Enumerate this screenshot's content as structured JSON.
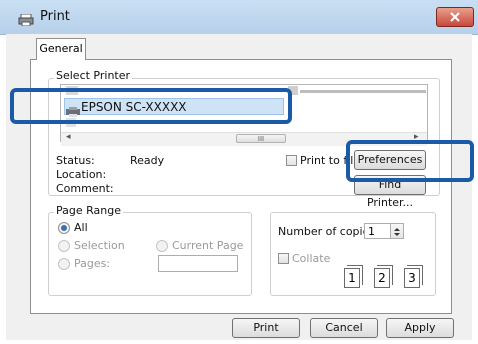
{
  "window": {
    "title": "Print",
    "title_icon": "printer-icon",
    "close_icon": "close-icon"
  },
  "tabs": [
    {
      "label": "General"
    }
  ],
  "select_printer": {
    "title": "Select Printer",
    "selected_printer": "EPSON SC-XXXXX",
    "scroll_thumb_glyph": "III",
    "scroll_left": "◂",
    "scroll_right": "▸"
  },
  "status": {
    "status_label": "Status:",
    "status_value": "Ready",
    "location_label": "Location:",
    "comment_label": "Comment:",
    "print_to_file_label": "Print to file",
    "preferences_label": "Preferences",
    "find_printer_label": "Find Printer..."
  },
  "page_range": {
    "title": "Page Range",
    "all_label": "All",
    "selection_label": "Selection",
    "current_page_label": "Current Page",
    "pages_label": "Pages:"
  },
  "copies": {
    "number_label": "Number of copies:",
    "number_value": "1",
    "collate_label": "Collate",
    "collate_pages": [
      "1",
      "1",
      "2",
      "2",
      "3",
      "3"
    ]
  },
  "footer": {
    "print_label": "Print",
    "cancel_label": "Cancel",
    "apply_label": "Apply"
  },
  "colors": {
    "highlight": "#1a5aa6",
    "selection": "#cfe3f7"
  }
}
